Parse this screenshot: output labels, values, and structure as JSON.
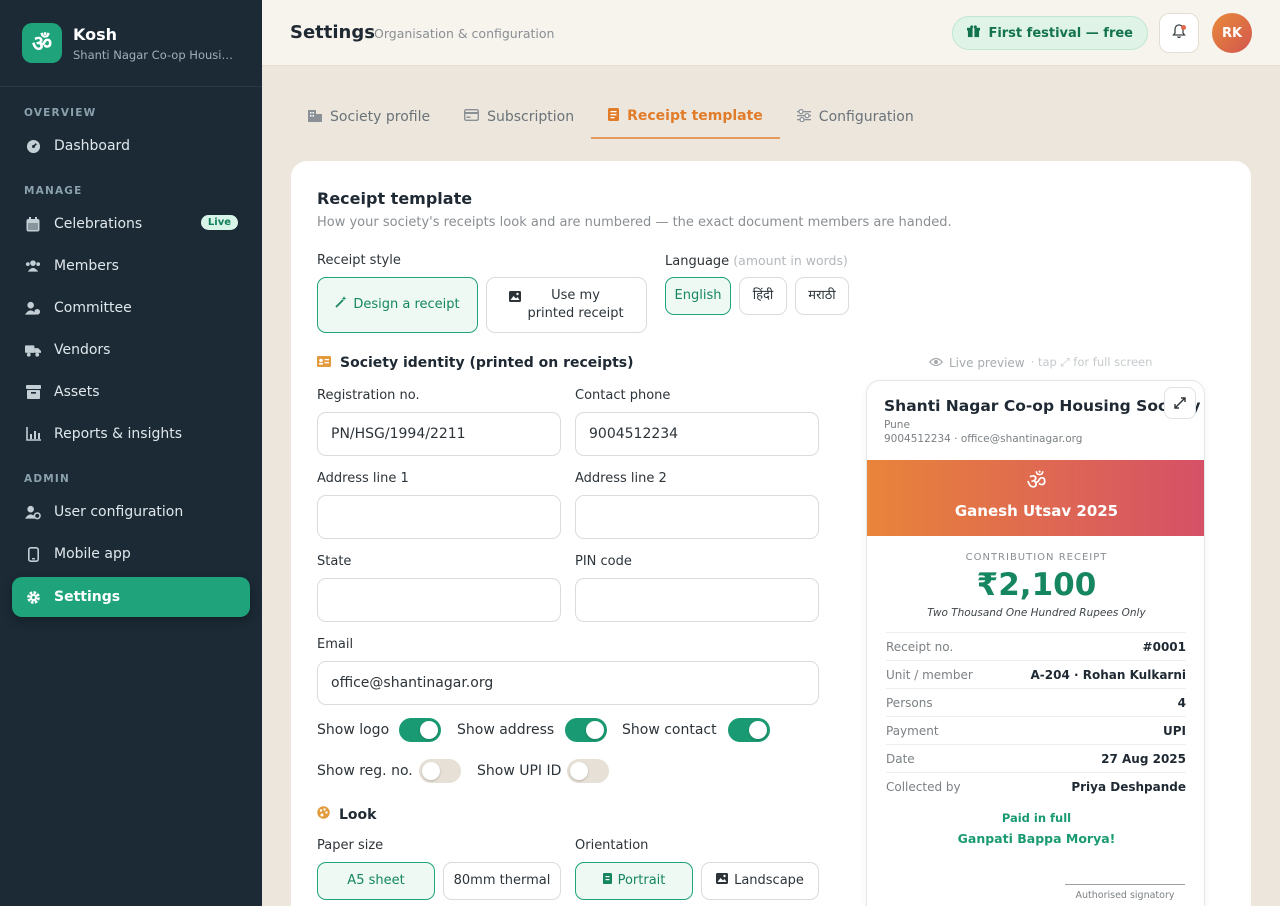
{
  "app": {
    "name": "Kosh",
    "org": "Shanti Nagar Co-op Housin...",
    "logo_glyph": "ॐ",
    "accent": "#1ea37a"
  },
  "sidebar": {
    "sections": [
      "OVERVIEW",
      "MANAGE",
      "ADMIN"
    ],
    "items": [
      {
        "label": "Dashboard",
        "icon": "dashboard-icon"
      },
      {
        "label": "Celebrations",
        "icon": "calendar-icon",
        "badge": "Live"
      },
      {
        "label": "Members",
        "icon": "members-icon"
      },
      {
        "label": "Committee",
        "icon": "committee-icon"
      },
      {
        "label": "Vendors",
        "icon": "truck-icon"
      },
      {
        "label": "Assets",
        "icon": "box-icon"
      },
      {
        "label": "Reports & insights",
        "icon": "chart-icon"
      },
      {
        "label": "User configuration",
        "icon": "user-gear-icon"
      },
      {
        "label": "Mobile app",
        "icon": "phone-icon"
      },
      {
        "label": "Settings",
        "icon": "gear-icon",
        "active": true
      }
    ]
  },
  "header": {
    "title": "Settings",
    "subtitle": "Organisation & configuration",
    "promo": "First festival — free",
    "avatar_initials": "RK"
  },
  "tabs": [
    {
      "label": "Society profile",
      "icon": "building-icon"
    },
    {
      "label": "Subscription",
      "icon": "card-icon"
    },
    {
      "label": "Receipt template",
      "icon": "receipt-icon",
      "active": true
    },
    {
      "label": "Configuration",
      "icon": "sliders-icon"
    }
  ],
  "receipt_template": {
    "title": "Receipt template",
    "subtitle": "How your society's receipts look and are numbered — the exact document members are handed.",
    "style_label": "Receipt style",
    "style_options": [
      "Design a receipt",
      "Use my printed receipt"
    ],
    "language_label": "Language",
    "language_hint": "(amount in words)",
    "language_options": [
      "English",
      "हिंदी",
      "मराठी"
    ],
    "identity_heading": "Society identity (printed on receipts)",
    "fields": {
      "reg_label": "Registration no.",
      "reg_value": "PN/HSG/1994/2211",
      "phone_label": "Contact phone",
      "phone_value": "9004512234",
      "addr1_label": "Address line 1",
      "addr1_value": "",
      "addr2_label": "Address line 2",
      "addr2_value": "",
      "state_label": "State",
      "state_value": "",
      "pin_label": "PIN code",
      "pin_value": "",
      "email_label": "Email",
      "email_value": "office@shantinagar.org"
    },
    "toggles": [
      {
        "label": "Show logo",
        "on": true
      },
      {
        "label": "Show address",
        "on": true
      },
      {
        "label": "Show contact",
        "on": true
      },
      {
        "label": "Show reg. no.",
        "on": false
      },
      {
        "label": "Show UPI ID",
        "on": false
      }
    ],
    "look_heading": "Look",
    "paper_label": "Paper size",
    "paper_options": [
      "A5 sheet",
      "80mm thermal"
    ],
    "orientation_label": "Orientation",
    "orientation_options": [
      "Portrait",
      "Landscape"
    ]
  },
  "preview": {
    "hint": "Live preview",
    "hint_extra": "· tap ⤢ for full screen",
    "society": "Shanti Nagar Co-op Housing Society",
    "city": "Pune",
    "contact": "9004512234 · office@shantinagar.org",
    "om": "ॐ",
    "event": "Ganesh Utsav 2025",
    "kind": "CONTRIBUTION RECEIPT",
    "amount": "₹2,100",
    "amount_words": "Two Thousand One Hundred Rupees Only",
    "rows": [
      {
        "k": "Receipt no.",
        "v": "#0001"
      },
      {
        "k": "Unit / member",
        "v": "A-204 · Rohan Kulkarni"
      },
      {
        "k": "Persons",
        "v": "4"
      },
      {
        "k": "Payment",
        "v": "UPI"
      },
      {
        "k": "Date",
        "v": "27 Aug 2025"
      },
      {
        "k": "Collected by",
        "v": "Priya Deshpande"
      }
    ],
    "paid": "Paid in full",
    "blessing": "Ganpati Bappa Morya!",
    "signatory": "Authorised signatory",
    "banner_colors": [
      "#e9843a",
      "#d55067"
    ]
  }
}
